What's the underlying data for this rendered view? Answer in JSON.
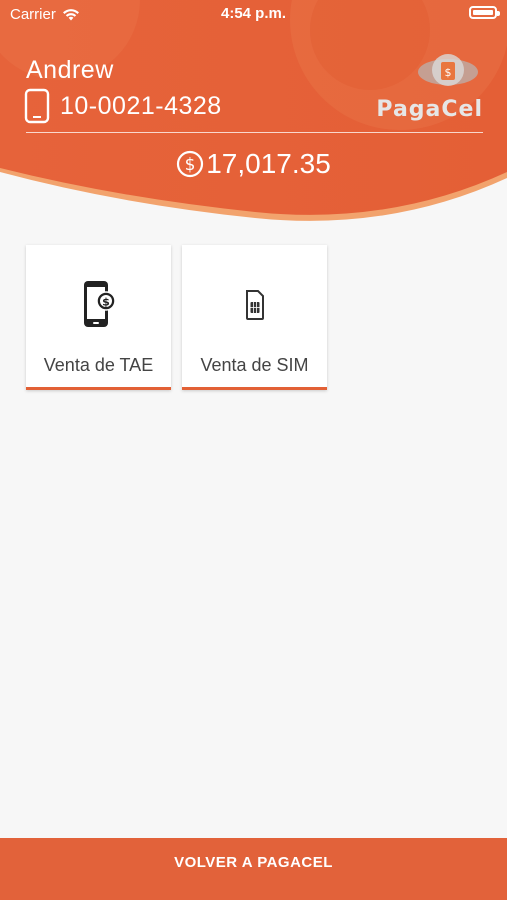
{
  "status_bar": {
    "carrier": "Carrier",
    "time": "4:54 p.m."
  },
  "user": {
    "name": "Andrew",
    "account_number": "10-0021-4328"
  },
  "brand": {
    "logo_text": "PagaCel",
    "accent_color": "#e26035"
  },
  "balance": {
    "amount": "17,017.35"
  },
  "services": [
    {
      "label": "Venta de TAE",
      "icon": "phone-dollar-icon"
    },
    {
      "label": "Venta de SIM",
      "icon": "sim-card-icon"
    }
  ],
  "bottom_bar": {
    "label": "VOLVER A PAGACEL"
  }
}
